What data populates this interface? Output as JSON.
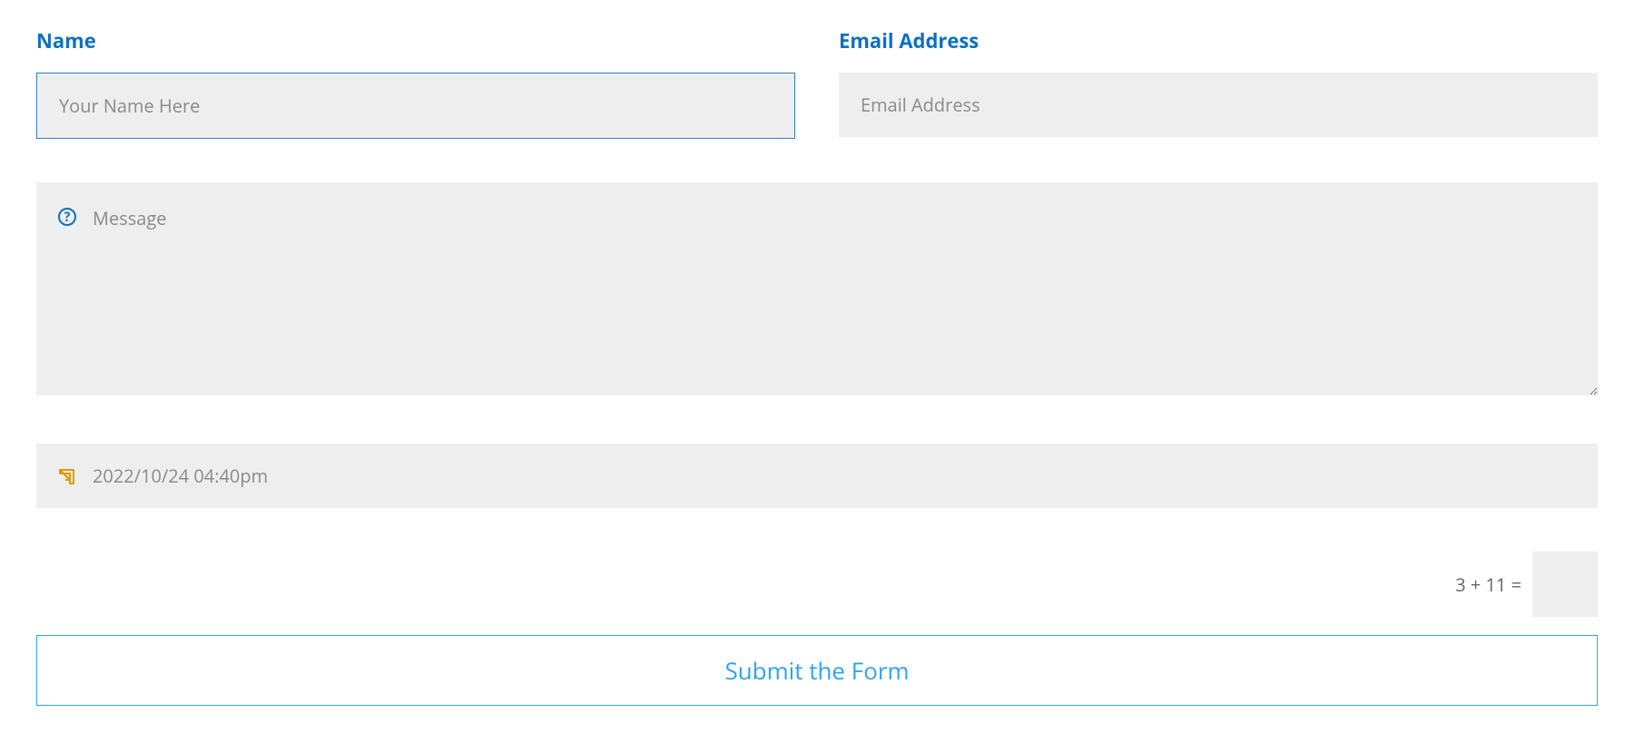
{
  "form": {
    "name": {
      "label": "Name",
      "placeholder": "Your Name Here",
      "value": ""
    },
    "email": {
      "label": "Email Address",
      "placeholder": "Email Address",
      "value": ""
    },
    "message": {
      "placeholder": "Message",
      "value": ""
    },
    "datetime": {
      "value": "2022/10/24 04:40pm"
    },
    "captcha": {
      "question": "3 + 11 =",
      "value": ""
    },
    "submit": {
      "label": "Submit the Form"
    }
  }
}
